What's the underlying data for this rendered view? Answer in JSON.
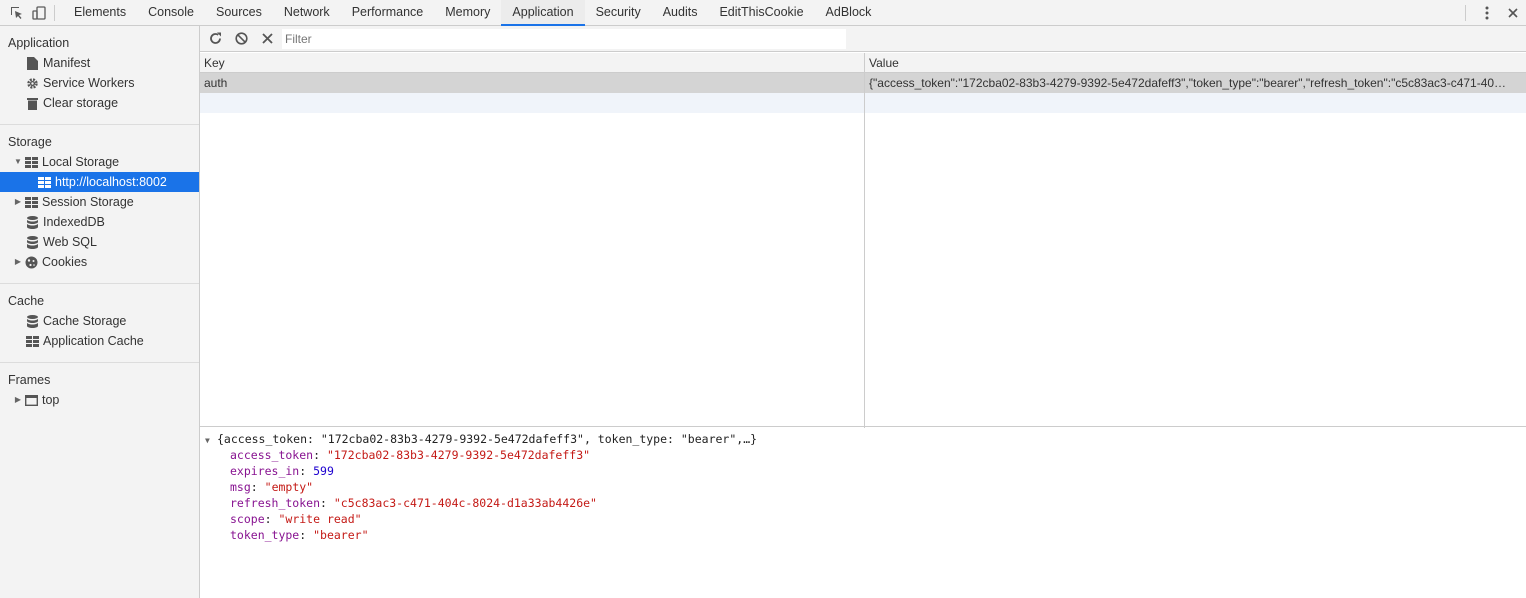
{
  "topbar": {
    "tabs": [
      "Elements",
      "Console",
      "Sources",
      "Network",
      "Performance",
      "Memory",
      "Application",
      "Security",
      "Audits",
      "EditThisCookie",
      "AdBlock"
    ],
    "active_tab": "Application"
  },
  "sidebar": {
    "application": {
      "title": "Application",
      "items": [
        "Manifest",
        "Service Workers",
        "Clear storage"
      ]
    },
    "storage": {
      "title": "Storage",
      "local_storage": "Local Storage",
      "local_origin": "http://localhost:8002",
      "session_storage": "Session Storage",
      "indexeddb": "IndexedDB",
      "websql": "Web SQL",
      "cookies": "Cookies"
    },
    "cache": {
      "title": "Cache",
      "items": [
        "Cache Storage",
        "Application Cache"
      ]
    },
    "frames": {
      "title": "Frames",
      "top": "top"
    }
  },
  "toolbar": {
    "filter_placeholder": "Filter"
  },
  "grid": {
    "key_header": "Key",
    "value_header": "Value",
    "rows": [
      {
        "key": "auth",
        "value": "{\"access_token\":\"172cba02-83b3-4279-9392-5e472dafeff3\",\"token_type\":\"bearer\",\"refresh_token\":\"c5c83ac3-c471-40…"
      }
    ]
  },
  "preview": {
    "summary": "{access_token: \"172cba02-83b3-4279-9392-5e472dafeff3\", token_type: \"bearer\",…}",
    "props": [
      {
        "key": "access_token",
        "value": "\"172cba02-83b3-4279-9392-5e472dafeff3\"",
        "kind": "string"
      },
      {
        "key": "expires_in",
        "value": "599",
        "kind": "number"
      },
      {
        "key": "msg",
        "value": "\"empty\"",
        "kind": "string"
      },
      {
        "key": "refresh_token",
        "value": "\"c5c83ac3-c471-404c-8024-d1a33ab4426e\"",
        "kind": "string"
      },
      {
        "key": "scope",
        "value": "\"write read\"",
        "kind": "string"
      },
      {
        "key": "token_type",
        "value": "\"bearer\"",
        "kind": "string"
      }
    ]
  },
  "colors": {
    "accent": "#1a73e8",
    "selected_row": "#d4d4d4",
    "key_purple": "#881391",
    "string_red": "#c41a16",
    "number_blue": "#1c00cf"
  }
}
